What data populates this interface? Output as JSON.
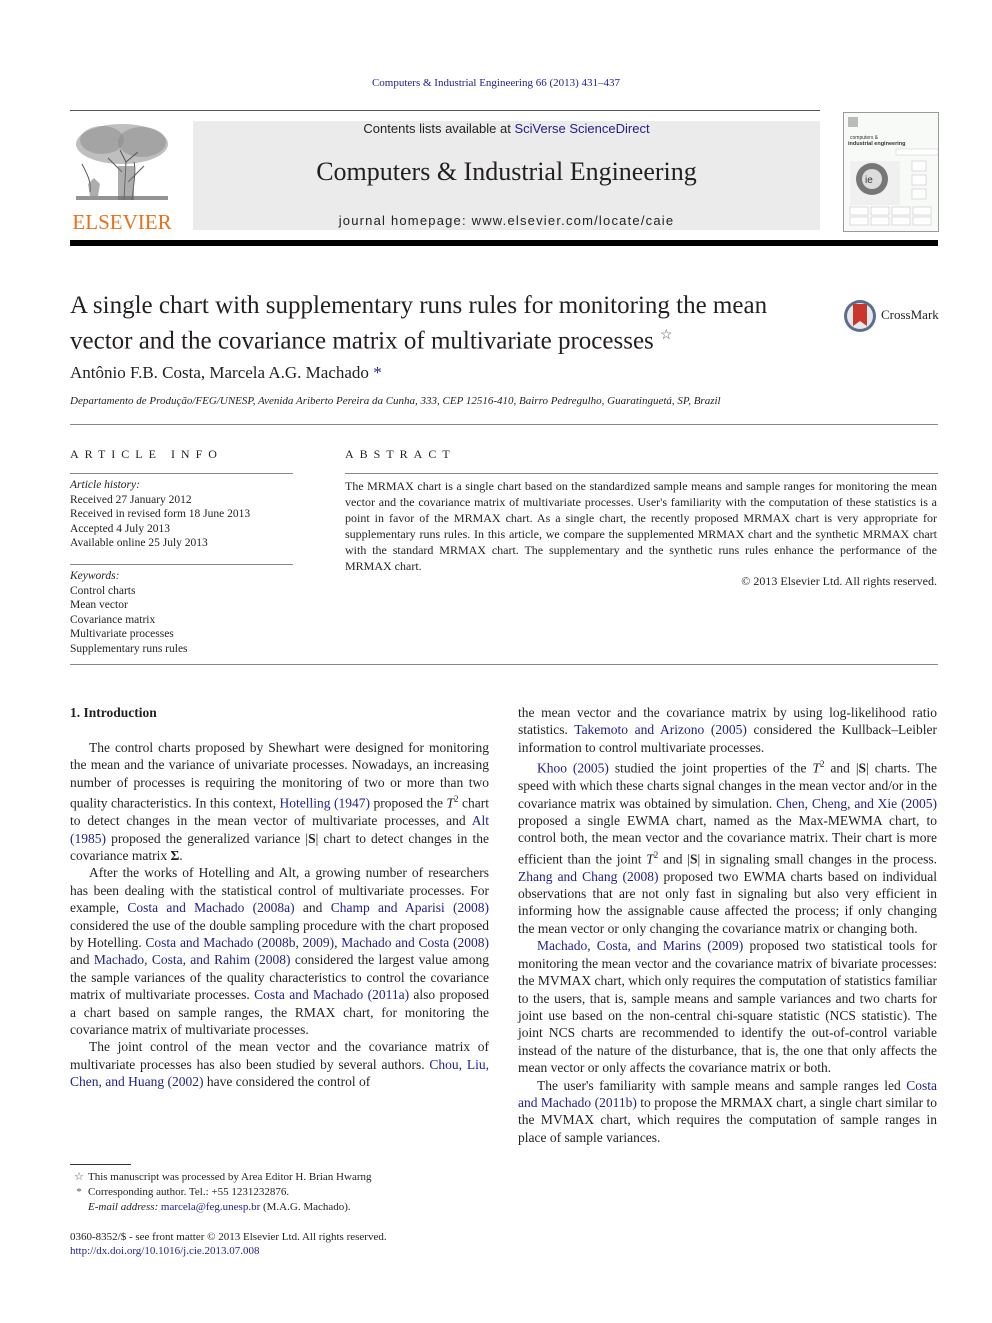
{
  "header": {
    "running_head": "Computers & Industrial Engineering 66 (2013) 431–437",
    "contents_prefix": "Contents lists available at ",
    "contents_link": "SciVerse ScienceDirect",
    "journal_title": "Computers & Industrial Engineering",
    "homepage": "journal homepage: www.elsevier.com/locate/caie",
    "publisher_logo_text": "ELSEVIER",
    "cover_text_1": "computers &",
    "cover_text_2": "industrial engineering",
    "cover_badge": "ie",
    "crossmark_label": "CrossMark",
    "colors": {
      "brand_orange": "#e9711c",
      "link_blue": "#1f1f8a",
      "banner_gray": "#ebebeb"
    }
  },
  "article": {
    "title": "A single chart with supplementary runs rules for monitoring the mean vector and the covariance matrix of multivariate processes",
    "title_note_mark": "☆",
    "authors": "Antônio F.B. Costa, Marcela A.G. Machado",
    "author_mark": "*",
    "affiliation": "Departamento de Produção/FEG/UNESP, Avenida Ariberto Pereira da Cunha, 333, CEP 12516-410, Bairro Pedregulho, Guaratinguetá, SP, Brazil"
  },
  "article_info": {
    "heading": "ARTICLE INFO",
    "history_label": "Article history:",
    "history": [
      "Received 27 January 2012",
      "Received in revised form 18 June 2013",
      "Accepted 4 July 2013",
      "Available online 25 July 2013"
    ],
    "keywords_label": "Keywords:",
    "keywords": [
      "Control charts",
      "Mean vector",
      "Covariance matrix",
      "Multivariate processes",
      "Supplementary runs rules"
    ]
  },
  "abstract": {
    "heading": "ABSTRACT",
    "text": "The MRMAX chart is a single chart based on the standardized sample means and sample ranges for monitoring the mean vector and the covariance matrix of multivariate processes. User's familiarity with the computation of these statistics is a point in favor of the MRMAX chart. As a single chart, the recently proposed MRMAX chart is very appropriate for supplementary runs rules. In this article, we compare the supplemented MRMAX chart and the synthetic MRMAX chart with the standard MRMAX chart. The supplementary and the synthetic runs rules enhance the performance of the MRMAX chart.",
    "copyright": "© 2013 Elsevier Ltd. All rights reserved."
  },
  "body": {
    "section_heading": "1. Introduction",
    "left": {
      "p1": [
        {
          "t": "The control charts proposed by Shewhart were designed for monitoring the mean and the variance of univariate processes. Nowadays, an increasing number of processes is requiring the monitoring of two or more than two quality characteristics. In this context, "
        },
        {
          "l": "Hotelling (1947)"
        },
        {
          "t": " proposed the "
        },
        {
          "m": "T"
        },
        {
          "s": "2"
        },
        {
          "t": " chart to detect changes in the mean vector of multivariate processes, and "
        },
        {
          "l": "Alt (1985)"
        },
        {
          "t": " proposed the generalized variance |"
        },
        {
          "b": "S"
        },
        {
          "t": "| chart to detect changes in the covariance matrix "
        },
        {
          "b": "Σ"
        },
        {
          "t": "."
        }
      ],
      "p2": [
        {
          "t": "After the works of Hotelling and Alt, a growing number of researchers has been dealing with the statistical control of multivariate processes. For example, "
        },
        {
          "l": "Costa and Machado (2008a)"
        },
        {
          "t": " and "
        },
        {
          "l": "Champ and Aparisi (2008)"
        },
        {
          "t": " considered the use of the double sampling procedure with the chart proposed by Hotelling. "
        },
        {
          "l": "Costa and Machado (2008b, 2009)"
        },
        {
          "t": ", "
        },
        {
          "l": "Machado and Costa (2008)"
        },
        {
          "t": " and "
        },
        {
          "l": "Machado, Costa, and Rahim (2008)"
        },
        {
          "t": " considered the largest value among the sample variances of the quality characteristics to control the covariance matrix of multivariate processes. "
        },
        {
          "l": "Costa and Machado (2011a)"
        },
        {
          "t": " also proposed a chart based on sample ranges, the RMAX chart, for monitoring the covariance matrix of multivariate processes."
        }
      ],
      "p3": [
        {
          "t": "The joint control of the mean vector and the covariance matrix of multivariate processes has also been studied by several authors. "
        },
        {
          "l": "Chou, Liu, Chen, and Huang (2002)"
        },
        {
          "t": " have considered the control of"
        }
      ]
    },
    "right": {
      "p0": [
        {
          "t": "the mean vector and the covariance matrix by using log-likelihood ratio statistics. "
        },
        {
          "l": "Takemoto and Arizono (2005)"
        },
        {
          "t": " considered the Kullback–Leibler information to control multivariate processes."
        }
      ],
      "p1": [
        {
          "l": "Khoo (2005)"
        },
        {
          "t": " studied the joint properties of the "
        },
        {
          "m": "T"
        },
        {
          "s": "2"
        },
        {
          "t": " and |"
        },
        {
          "b": "S"
        },
        {
          "t": "| charts. The speed with which these charts signal changes in the mean vector and/or in the covariance matrix was obtained by simulation. "
        },
        {
          "l": "Chen, Cheng, and Xie (2005)"
        },
        {
          "t": " proposed a single EWMA chart, named as the Max-MEWMA chart, to control both, the mean vector and the covariance matrix. Their chart is more efficient than the joint "
        },
        {
          "m": "T"
        },
        {
          "s": "2"
        },
        {
          "t": " and |"
        },
        {
          "b": "S"
        },
        {
          "t": "| in signaling small changes in the process. "
        },
        {
          "l": "Zhang and Chang (2008)"
        },
        {
          "t": " proposed two EWMA charts based on individual observations that are not only fast in signaling but also very efficient in informing how the assignable cause affected the process; if only changing the mean vector or only changing the covariance matrix or changing both."
        }
      ],
      "p2": [
        {
          "l": "Machado, Costa, and Marins (2009)"
        },
        {
          "t": " proposed two statistical tools for monitoring the mean vector and the covariance matrix of bivariate processes: the MVMAX chart, which only requires the computation of statistics familiar to the users, that is, sample means and sample variances and two charts for joint use based on the non-central chi-square statistic (NCS statistic). The joint NCS charts are recommended to identify the out-of-control variable instead of the nature of the disturbance, that is, the one that only affects the mean vector or only affects the covariance matrix or both."
        }
      ],
      "p3": [
        {
          "t": "The user's familiarity with sample means and sample ranges led "
        },
        {
          "l": "Costa and Machado (2011b)"
        },
        {
          "t": " to propose the MRMAX chart, a single chart similar to the MVMAX chart, which requires the computation of sample ranges in place of sample variances."
        }
      ]
    }
  },
  "footnotes": {
    "note1_mark": "☆",
    "note1": "This manuscript was processed by Area Editor H. Brian Hwarng",
    "note2_mark": "*",
    "note2": "Corresponding author. Tel.: +55 1231232876.",
    "email_label": "E-mail address: ",
    "email": "marcela@feg.unesp.br",
    "email_suffix": " (M.A.G. Machado).",
    "issn_line": "0360-8352/$ - see front matter © 2013 Elsevier Ltd. All rights reserved.",
    "doi": "http://dx.doi.org/10.1016/j.cie.2013.07.008"
  }
}
